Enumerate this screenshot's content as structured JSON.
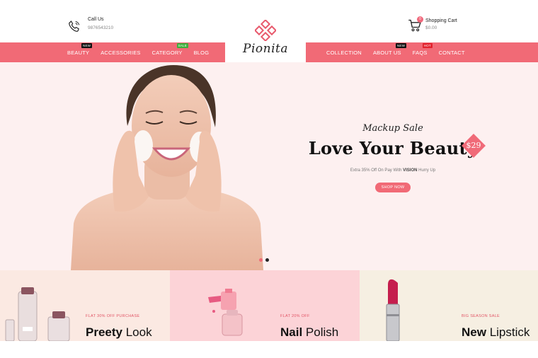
{
  "header": {
    "call_label": "Call Us",
    "phone": "9876543210",
    "cart_label": "Shopping Cart",
    "cart_total": "$0.00",
    "cart_count": "0"
  },
  "logo": {
    "brand": "Pionita"
  },
  "nav_left": [
    {
      "label": "BEAUTY",
      "tag": "NEW"
    },
    {
      "label": "ACCESSORIES",
      "tag": ""
    },
    {
      "label": "CATEGORY",
      "tag": "SALE"
    },
    {
      "label": "BLOG",
      "tag": ""
    }
  ],
  "nav_right": [
    {
      "label": "COLLECTION",
      "tag": ""
    },
    {
      "label": "ABOUT US",
      "tag": "NEW"
    },
    {
      "label": "FAQS",
      "tag": "HOT"
    },
    {
      "label": "CONTACT",
      "tag": ""
    }
  ],
  "hero": {
    "kicker": "Mackup Sale",
    "headline": "Love Your Beauty",
    "offer_prefix": "Extra 35% Off On Pay With ",
    "offer_code": "VISION",
    "offer_suffix": " Hurry Up",
    "cta": "SHOP NOW",
    "price": "$29",
    "active_slide": 1,
    "slide_count": 2
  },
  "banners": [
    {
      "label": "FLAT 30% OFF PURCHASE",
      "title_bold": "Preety",
      "title_rest": " Look"
    },
    {
      "label": "FLAT 20% OFF",
      "title_bold": "Nail",
      "title_rest": " Polish"
    },
    {
      "label": "BIG SEASON SALE",
      "title_bold": "New",
      "title_rest": " Lipstick"
    }
  ],
  "colors": {
    "accent": "#f16a76",
    "hero_bg": "#fdf0f0",
    "dot_active": "#f16a76",
    "dot_inactive": "#222222"
  }
}
